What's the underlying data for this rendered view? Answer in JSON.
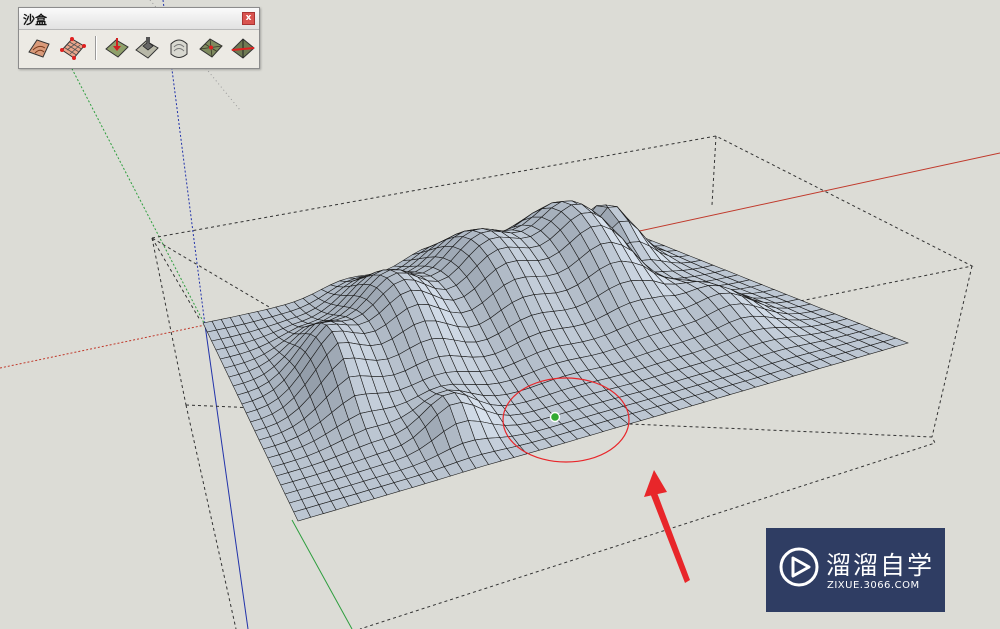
{
  "toolbar": {
    "title": "沙盒",
    "close_label": "x",
    "tools": [
      {
        "icon": "sandbox-from-contours-icon"
      },
      {
        "icon": "sandbox-from-scratch-icon"
      },
      {
        "icon": "smoove-icon"
      },
      {
        "icon": "stamp-icon"
      },
      {
        "icon": "drape-icon"
      },
      {
        "icon": "add-detail-icon"
      },
      {
        "icon": "flip-edge-icon"
      }
    ]
  },
  "watermark": {
    "brand": "溜溜自学",
    "url": "ZIXUE.3066.COM",
    "background": "#2f3d63"
  },
  "colors": {
    "viewport_background": "#dcdcd6",
    "terrain_face": "#c9d3dc",
    "terrain_edge": "#1c1c1c",
    "brush_circle": "#e8262a",
    "annotation_arrow": "#e8262a",
    "red_axis": "#c0392b",
    "green_axis": "#2e9e3e",
    "blue_axis": "#2233aa"
  }
}
